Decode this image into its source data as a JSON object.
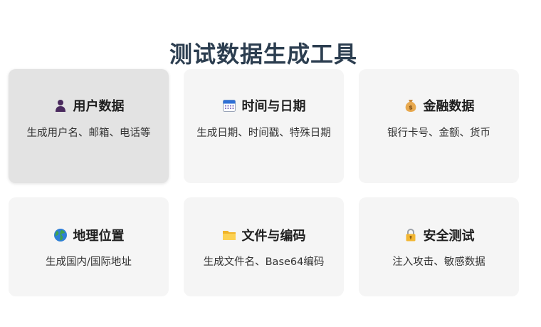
{
  "page": {
    "title": "测试数据生成工具"
  },
  "cards": [
    {
      "title": "用户数据",
      "description": "生成用户名、邮箱、电话等",
      "icon": "user-icon"
    },
    {
      "title": "时间与日期",
      "description": "生成日期、时间戳、特殊日期",
      "icon": "calendar-icon"
    },
    {
      "title": "金融数据",
      "description": "银行卡号、金额、货币",
      "icon": "money-bag-icon"
    },
    {
      "title": "地理位置",
      "description": "生成国内/国际地址",
      "icon": "globe-icon"
    },
    {
      "title": "文件与编码",
      "description": "生成文件名、Base64编码",
      "icon": "folder-icon"
    },
    {
      "title": "安全测试",
      "description": "注入攻击、敏感数据",
      "icon": "lock-icon"
    }
  ],
  "colors": {
    "title": "#2c3e50",
    "card_bg": "#f5f5f5",
    "card_hover_bg": "#e3e3e3"
  }
}
